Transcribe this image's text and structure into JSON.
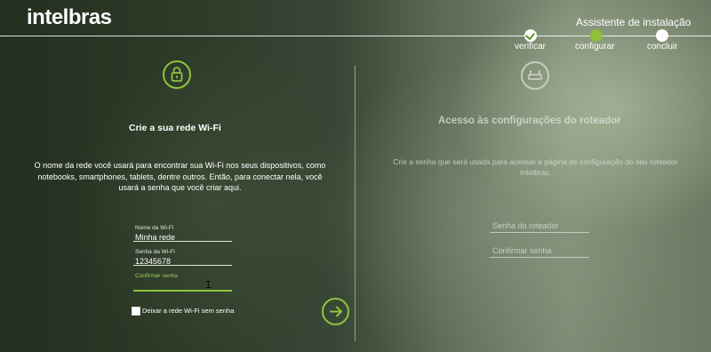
{
  "brand": {
    "logo_text": "intelbras"
  },
  "wizard": {
    "title": "Assistente de instalação",
    "steps": [
      {
        "label": "verificar",
        "state": "done"
      },
      {
        "label": "configurar",
        "state": "active"
      },
      {
        "label": "concluir",
        "state": "pending"
      }
    ]
  },
  "wifi_panel": {
    "icon": "lock-icon",
    "title": "Crie a sua rede Wi-Fi",
    "description": "O nome da rede você usará para encontrar sua Wi-Fi nos seus dispositivos, como notebooks, smartphones, tablets, dentre outros. Então, para conectar nela, você usará a senha que você criar aqui.",
    "fields": {
      "name_label": "Nome da Wi-Fi",
      "name_value": "Minha rede",
      "password_label": "Senha da Wi-Fi",
      "password_value": "12345678",
      "confirm_label": "Confirmar senha",
      "confirm_value": ""
    },
    "no_password_checkbox_label": "Deixar a rede Wi-Fi sem senha",
    "no_password_checked": false,
    "next_icon": "arrow-right-icon"
  },
  "router_panel": {
    "icon": "router-icon",
    "title": "Acesso às configurações do roteador",
    "description": "Crie a senha que será usada para acessar a página de configuração do seu roteador Intelbras.",
    "password_placeholder": "Senha do roteador",
    "confirm_placeholder": "Confirmar senha"
  },
  "colors": {
    "accent": "#8bc53f",
    "text": "#ffffff",
    "muted_text": "#e1e4dc"
  }
}
